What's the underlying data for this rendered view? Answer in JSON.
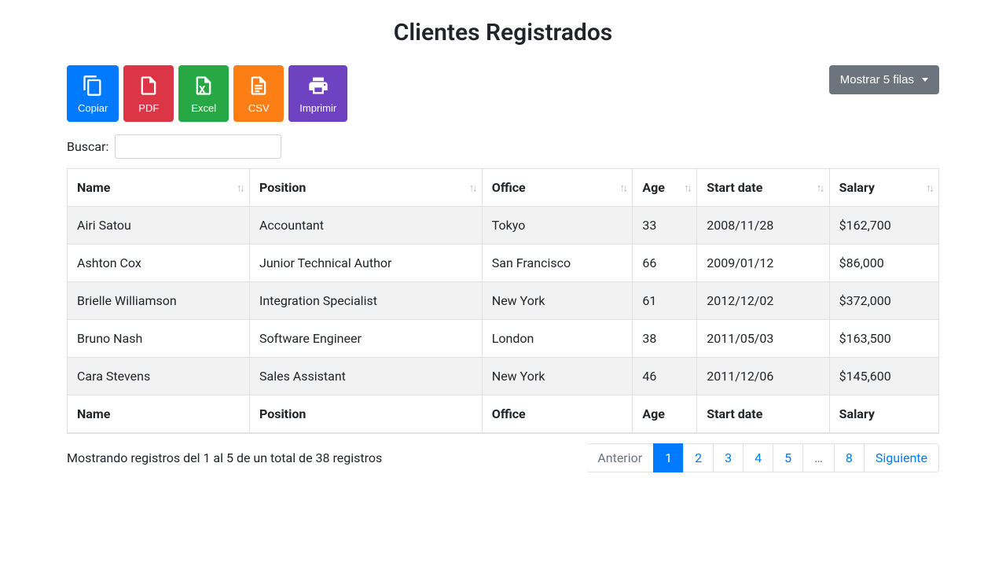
{
  "title": "Clientes Registrados",
  "export_buttons": {
    "copy": {
      "label": "Copiar",
      "icon": "copy-icon"
    },
    "pdf": {
      "label": "PDF",
      "icon": "file-pdf-icon"
    },
    "excel": {
      "label": "Excel",
      "icon": "file-excel-icon"
    },
    "csv": {
      "label": "CSV",
      "icon": "file-text-icon"
    },
    "print": {
      "label": "Imprimir",
      "icon": "print-icon"
    }
  },
  "rows_dropdown_label": "Mostrar 5 filas",
  "search": {
    "label": "Buscar:",
    "value": "",
    "placeholder": ""
  },
  "columns": [
    "Name",
    "Position",
    "Office",
    "Age",
    "Start date",
    "Salary"
  ],
  "rows": [
    {
      "name": "Airi Satou",
      "position": "Accountant",
      "office": "Tokyo",
      "age": "33",
      "start": "2008/11/28",
      "salary": "$162,700"
    },
    {
      "name": "Ashton Cox",
      "position": "Junior Technical Author",
      "office": "San Francisco",
      "age": "66",
      "start": "2009/01/12",
      "salary": "$86,000"
    },
    {
      "name": "Brielle Williamson",
      "position": "Integration Specialist",
      "office": "New York",
      "age": "61",
      "start": "2012/12/02",
      "salary": "$372,000"
    },
    {
      "name": "Bruno Nash",
      "position": "Software Engineer",
      "office": "London",
      "age": "38",
      "start": "2011/05/03",
      "salary": "$163,500"
    },
    {
      "name": "Cara Stevens",
      "position": "Sales Assistant",
      "office": "New York",
      "age": "46",
      "start": "2011/12/06",
      "salary": "$145,600"
    }
  ],
  "info_text": "Mostrando registros del 1 al 5 de un total de 38 registros",
  "pagination": {
    "prev": "Anterior",
    "next": "Siguiente",
    "pages": [
      "1",
      "2",
      "3",
      "4",
      "5",
      "…",
      "8"
    ],
    "active_index": 0,
    "ellipsis_index": 5
  }
}
